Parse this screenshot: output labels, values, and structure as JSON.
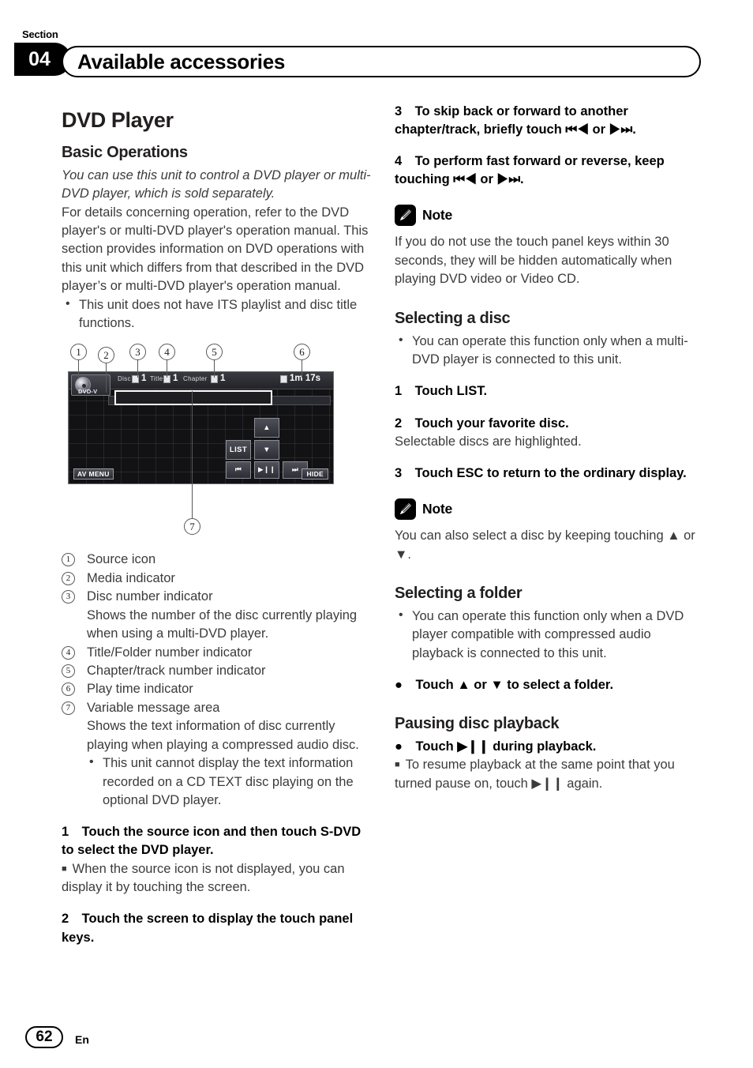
{
  "header": {
    "section_word": "Section",
    "section_number": "04",
    "title": "Available accessories"
  },
  "left_column": {
    "main_title": "DVD Player",
    "basic_operations_heading": "Basic Operations",
    "intro_italic": "You can use this unit to control a DVD player or multi-DVD player, which is sold separately.",
    "intro_body": "For details concerning operation, refer to the DVD player's or multi-DVD player's operation manual. This section provides information on DVD operations with this unit which differs from that described in the DVD player’s or multi-DVD player's operation manual.",
    "intro_bullet": "This unit does not have ITS playlist and disc title functions.",
    "key_list": [
      {
        "num": "①",
        "label": "Source icon",
        "desc": ""
      },
      {
        "num": "②",
        "label": "Media indicator",
        "desc": ""
      },
      {
        "num": "③",
        "label": "Disc number indicator",
        "desc": "Shows the number of the disc currently playing when using a multi-DVD player."
      },
      {
        "num": "④",
        "label": "Title/Folder number indicator",
        "desc": ""
      },
      {
        "num": "⑤",
        "label": "Chapter/track number indicator",
        "desc": ""
      },
      {
        "num": "⑥",
        "label": "Play time indicator",
        "desc": ""
      },
      {
        "num": "⑦",
        "label": "Variable message area",
        "desc": "Shows the text information of disc currently playing when playing a compressed audio disc."
      }
    ],
    "key_sub_bullet": "This unit cannot display the text information recorded on a CD TEXT disc playing on the optional DVD player.",
    "step1": "1 Touch the source icon and then touch S-DVD to select the DVD player.",
    "step1_note": "When the source icon is not displayed, you can display it by touching the screen.",
    "step2": "2 Touch the screen to display the touch panel keys."
  },
  "diagram": {
    "callouts": [
      "①",
      "②",
      "③",
      "④",
      "⑤",
      "⑥",
      "⑦"
    ],
    "callout_digits": [
      "1",
      "2",
      "3",
      "4",
      "5",
      "6",
      "7"
    ],
    "source_label": "DVD-V",
    "disc_label": "Disc",
    "disc_value": "1",
    "title_label": "Title",
    "title_value": "1",
    "chapter_label": "Chapter",
    "chapter_value": "1",
    "time_value": "1m 17s",
    "btn_list": "LIST",
    "btn_up": "▲",
    "btn_down": "▼",
    "btn_prev": "⏮",
    "btn_playpause": "▶❙❙",
    "btn_next": "⏭",
    "btn_av_menu": "AV MENU",
    "btn_hide": "HIDE"
  },
  "right_column": {
    "step3": "3 To skip back or forward to another chapter/track, briefly touch ⏮◀ or ▶⏭.",
    "step4": "4 To perform fast forward or reverse, keep touching ⏮◀ or ▶⏭.",
    "note_label": "Note",
    "note1_body": "If you do not use the touch panel keys within 30 seconds, they will be hidden automatically when playing DVD video or Video CD.",
    "selecting_disc_heading": "Selecting a disc",
    "selecting_disc_bullet": "You can operate this function only when a multi-DVD player is connected to this unit.",
    "disc_step1": "1 Touch LIST.",
    "disc_step2": "2 Touch your favorite disc.",
    "disc_step2_body": "Selectable discs are highlighted.",
    "disc_step3": "3 Touch ESC to return to the ordinary display.",
    "note2_label": "Note",
    "note2_body": "You can also select a disc by keeping touching ▲ or ▼.",
    "selecting_folder_heading": "Selecting a folder",
    "selecting_folder_bullet": "You can operate this function only when a DVD player compatible with compressed audio playback is connected to this unit.",
    "folder_step": " Touch ▲ or ▼ to select a folder.",
    "pausing_heading": "Pausing disc playback",
    "pausing_step": " Touch ▶❙❙ during playback.",
    "pausing_note": "To resume playback at the same point that you turned pause on, touch ▶❙❙ again."
  },
  "footer": {
    "page_number": "62",
    "language": "En"
  }
}
